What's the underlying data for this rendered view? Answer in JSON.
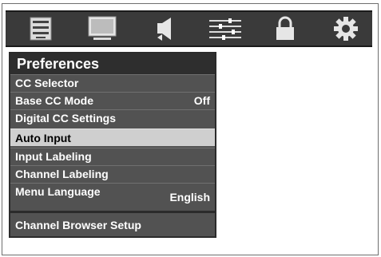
{
  "colors": {
    "icon_bar_bg": "#3a3a3a",
    "menu_bg": "#525252",
    "title_bg": "#2e2e2e",
    "selected_bg": "#cfcfcf"
  },
  "icon_bar": {
    "icons": [
      {
        "name": "picture-settings-icon"
      },
      {
        "name": "tv-screen-icon"
      },
      {
        "name": "speaker-icon"
      },
      {
        "name": "sliders-icon"
      },
      {
        "name": "lock-icon"
      },
      {
        "name": "gear-icon"
      }
    ]
  },
  "menu": {
    "title": "Preferences",
    "items": [
      {
        "label": "CC Selector",
        "value": ""
      },
      {
        "label": "Base CC Mode",
        "value": "Off"
      },
      {
        "label": "Digital CC Settings",
        "value": ""
      },
      {
        "label": "Auto Input",
        "value": "",
        "selected": true
      },
      {
        "label": "Input Labeling",
        "value": ""
      },
      {
        "label": "Channel Labeling",
        "value": ""
      },
      {
        "label": "Menu Language",
        "value": "English"
      },
      {
        "label": "Channel Browser Setup",
        "value": ""
      }
    ]
  }
}
